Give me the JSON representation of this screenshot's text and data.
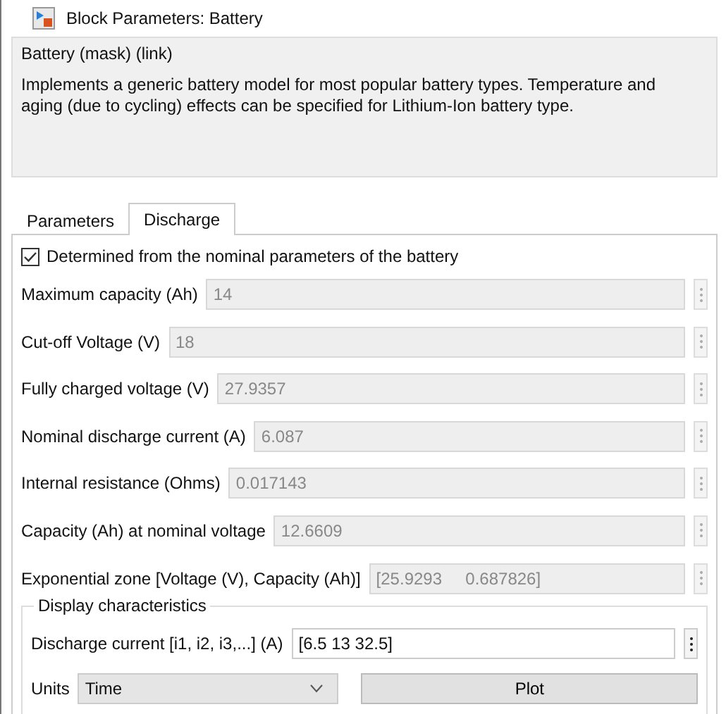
{
  "window": {
    "title": "Block Parameters: Battery"
  },
  "mask": {
    "title": "Battery (mask) (link)",
    "description": "Implements a generic battery model for most popular battery types. Temperature and aging (due to cycling) effects can be specified for Lithium-Ion battery type."
  },
  "tabs": [
    {
      "label": "Parameters",
      "selected": false
    },
    {
      "label": "Discharge",
      "selected": true
    }
  ],
  "checkbox": {
    "label": "Determined from the nominal parameters of the battery",
    "checked": true
  },
  "fields": [
    {
      "label": "Maximum capacity (Ah)",
      "value": "14",
      "disabled": true
    },
    {
      "label": "Cut-off Voltage (V)",
      "value": "18",
      "disabled": true
    },
    {
      "label": "Fully charged voltage (V)",
      "value": "27.9357",
      "disabled": true
    },
    {
      "label": "Nominal discharge current (A)",
      "value": "6.087",
      "disabled": true
    },
    {
      "label": "Internal resistance (Ohms)",
      "value": "0.017143",
      "disabled": true
    },
    {
      "label": "Capacity (Ah) at nominal voltage",
      "value": "12.6609",
      "disabled": true
    },
    {
      "label": "Exponential zone [Voltage (V), Capacity (Ah)]",
      "value": "[25.9293     0.687826]",
      "disabled": true
    }
  ],
  "display": {
    "title": "Display characteristics",
    "field": {
      "label": "Discharge current [i1, i2, i3,...] (A)",
      "value": "[6.5 13 32.5]",
      "disabled": false
    },
    "units": {
      "label": "Units",
      "value": "Time"
    },
    "button": "Plot"
  }
}
